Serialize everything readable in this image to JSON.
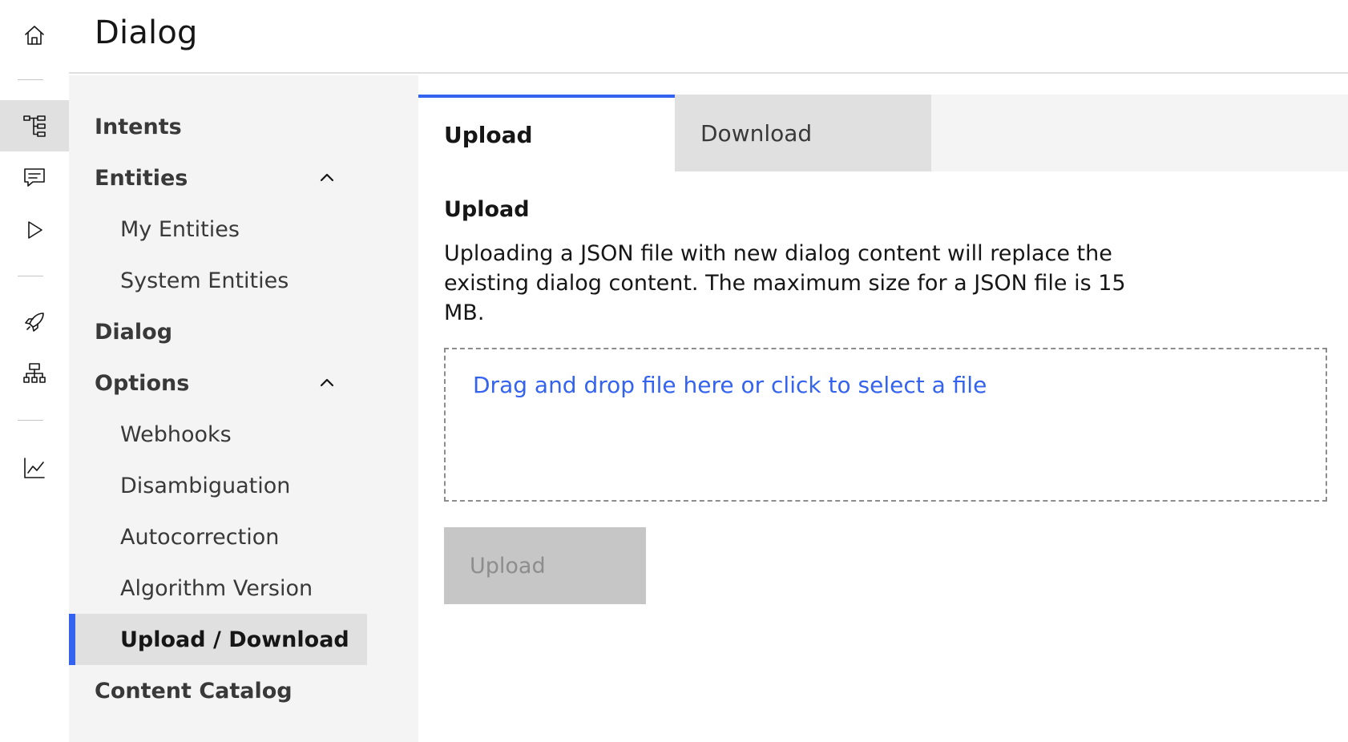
{
  "header": {
    "title": "Dialog"
  },
  "rail": {
    "icons": [
      "home-icon",
      "dialog-tree-icon",
      "message-icon",
      "play-icon",
      "rocket-icon",
      "hierarchy-icon",
      "chart-line-icon"
    ],
    "active": "dialog-tree-icon"
  },
  "subnav": {
    "intents": "Intents",
    "entities": "Entities",
    "my_entities": "My Entities",
    "system_entities": "System Entities",
    "dialog": "Dialog",
    "options": "Options",
    "webhooks": "Webhooks",
    "disambiguation": "Disambiguation",
    "autocorrection": "Autocorrection",
    "algorithm_version": "Algorithm Version",
    "upload_download": "Upload / Download",
    "content_catalog": "Content Catalog"
  },
  "tabs": {
    "upload": "Upload",
    "download": "Download"
  },
  "upload_section": {
    "title": "Upload",
    "description": "Uploading a JSON file with new dialog content will replace the existing dialog content. The maximum size for a JSON file is 15 MB.",
    "dropzone_text": "Drag and drop file here or click to select a file",
    "button_label": "Upload"
  },
  "colors": {
    "accent": "#3463f0",
    "nav_bg": "#f4f4f4",
    "selected_bg": "#e0e0e0",
    "disabled_button": "#c6c6c6"
  }
}
